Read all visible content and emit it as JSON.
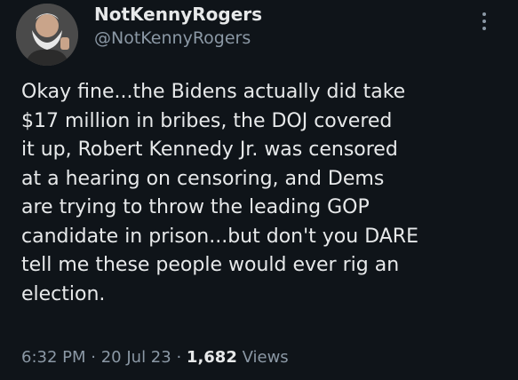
{
  "author": {
    "display_name": "NotKennyRogers",
    "handle": "@NotKennyRogers"
  },
  "tweet": {
    "lines": [
      "Okay fine...the Bidens actually did take",
      "$17 million in bribes, the DOJ covered",
      "it up, Robert Kennedy Jr. was censored",
      "at a hearing on censoring, and Dems",
      "are trying to throw the leading GOP",
      "candidate in prison...but don't you DARE",
      "tell me these people would ever rig an",
      "election."
    ]
  },
  "meta": {
    "time": "6:32 PM",
    "separator": "·",
    "date": "20 Jul 23",
    "views_count": "1,682",
    "views_label": "Views"
  },
  "icons": {
    "more": "more-vertical-icon",
    "avatar": "avatar"
  },
  "colors": {
    "background": "#0f1419",
    "text": "#e7e9ea",
    "secondary": "#8b98a5"
  }
}
